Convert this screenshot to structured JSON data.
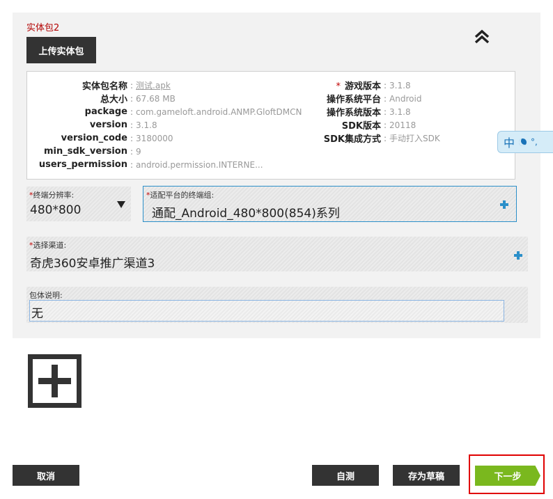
{
  "package_section": {
    "title": "实体包2",
    "upload_button": "上传实体包"
  },
  "info": {
    "left": [
      {
        "label": "实体包名称",
        "value": "测试.apk",
        "link": true
      },
      {
        "label": "总大小",
        "value": "67.68 MB"
      },
      {
        "label": "package",
        "value": "com.gameloft.android.ANMP.GloftDMCN"
      },
      {
        "label": "version",
        "value": "3.1.8"
      },
      {
        "label": "version_code",
        "value": "3180000"
      },
      {
        "label": "min_sdk_version",
        "value": "9"
      },
      {
        "label": "users_permission",
        "value": "android.permission.INTERNE..."
      }
    ],
    "right": [
      {
        "label": "游戏版本",
        "value": "3.1.8",
        "required": true
      },
      {
        "label": "操作系统平台",
        "value": "Android"
      },
      {
        "label": "操作系统版本",
        "value": "3.1.8"
      },
      {
        "label": "SDK版本",
        "value": "20118"
      },
      {
        "label": "SDK集成方式",
        "value": "手动打入SDK"
      }
    ],
    "separator": ":",
    "required_mark": "*"
  },
  "ime": {
    "label": "中",
    "extra": "°,"
  },
  "fields": {
    "resolution": {
      "label": "终端分辨率:",
      "value": "480*800"
    },
    "terminal_group": {
      "label": "适配平台的终端组:",
      "value": "通配_Android_480*800(854)系列"
    },
    "channel": {
      "label": "选择渠道:",
      "value": "奇虎360安卓推广渠道3"
    },
    "description": {
      "label": "包体说明:",
      "value": "无"
    },
    "required_mark": "*"
  },
  "footer": {
    "cancel": "取消",
    "self_test": "自测",
    "save_draft": "存为草稿",
    "next": "下一步"
  },
  "colors": {
    "accent_green": "#7ab81e",
    "highlight_red": "#e00000",
    "dark_button": "#333333",
    "plus_blue": "#2b8fc9"
  }
}
